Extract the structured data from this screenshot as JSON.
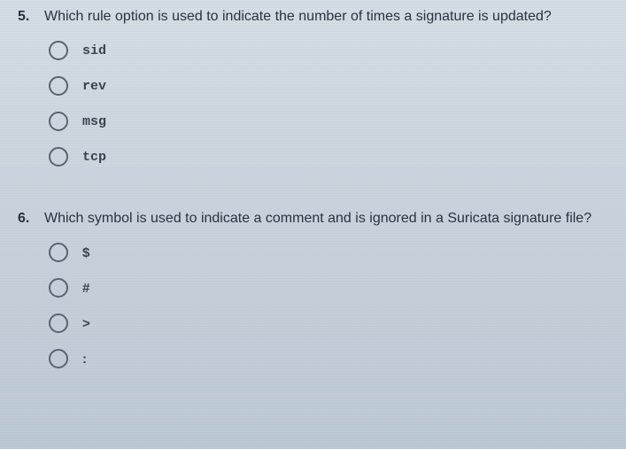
{
  "questions": [
    {
      "number": "5.",
      "text": "Which rule option is used to indicate the number of times a signature is updated?",
      "options": [
        {
          "label": "sid",
          "style": "mono"
        },
        {
          "label": "rev",
          "style": "mono"
        },
        {
          "label": "msg",
          "style": "mono"
        },
        {
          "label": "tcp",
          "style": "mono"
        }
      ]
    },
    {
      "number": "6.",
      "text": "Which symbol is used to indicate a comment and is ignored in a Suricata signature file?",
      "options": [
        {
          "label": "$",
          "style": "plain"
        },
        {
          "label": "#",
          "style": "plain"
        },
        {
          "label": ">",
          "style": "plain"
        },
        {
          "label": ":",
          "style": "plain"
        }
      ]
    }
  ]
}
